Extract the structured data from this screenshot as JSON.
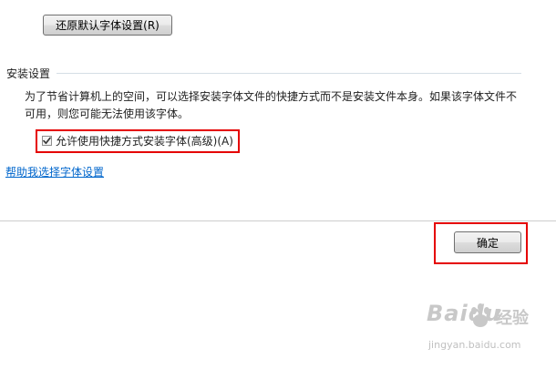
{
  "restore_button": {
    "label": "还原默认字体设置(R)"
  },
  "install_settings": {
    "title": "安装设置",
    "description": "为了节省计算机上的空间，可以选择安装字体文件的快捷方式而不是安装文件本身。如果该字体文件不可用，则您可能无法使用该字体。",
    "shortcut_checkbox": {
      "label": "允许使用快捷方式安装字体(高级)(A)",
      "checked": true
    }
  },
  "help_link": {
    "label": "帮助我选择字体设置"
  },
  "ok_button": {
    "label": "确定"
  },
  "watermark": {
    "logo_text": "Baidu",
    "cn_text": "经验",
    "url": "jingyan.baidu.com"
  },
  "colors": {
    "highlight": "#e50000",
    "link": "#0066cc"
  }
}
